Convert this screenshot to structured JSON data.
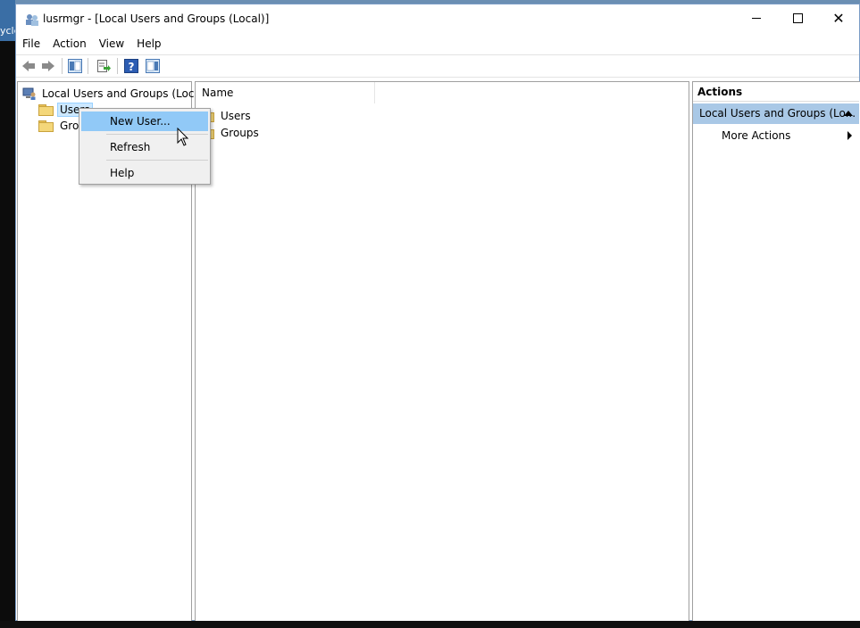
{
  "desktop": {
    "recycle_label": "ycle"
  },
  "window": {
    "title": "lusrmgr - [Local Users and Groups (Local)]",
    "controls": {
      "minimize": "minimize-icon",
      "maximize": "maximize-icon",
      "close": "close-icon"
    }
  },
  "menu": [
    "File",
    "Action",
    "View",
    "Help"
  ],
  "toolbar": [
    "back-arrow-icon",
    "forward-arrow-icon",
    "show-hide-tree-icon",
    "export-list-icon",
    "help-icon",
    "show-hide-action-pane-icon"
  ],
  "tree": {
    "root": "Local Users and Groups (Local)",
    "items": [
      "Users",
      "Groups"
    ],
    "items_visible": [
      "Users",
      "Grou"
    ]
  },
  "list": {
    "column": "Name",
    "rows": [
      "Users",
      "Groups"
    ]
  },
  "actions": {
    "header": "Actions",
    "section": "Local Users and Groups (Lo...",
    "more": "More Actions"
  },
  "context_menu": {
    "items": [
      "New User...",
      "Refresh",
      "Help"
    ],
    "highlighted": "New User..."
  },
  "colors": {
    "selection": "#cce8ff",
    "menu_highlight": "#91c9f7",
    "actions_section": "#a9c8e6",
    "folder": "#f4d77a"
  }
}
